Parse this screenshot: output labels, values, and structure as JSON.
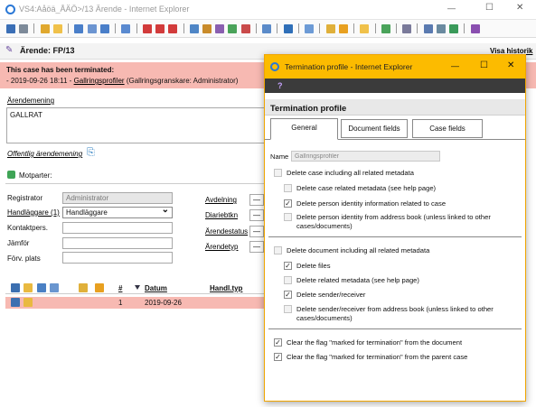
{
  "window": {
    "title": "VS4:Aåöä_ÅÄÖ>/13 Ärende - Internet Explorer",
    "min": "—",
    "max": "☐",
    "close": "✕"
  },
  "header": {
    "icon": "✎",
    "title": "Ärende: FP/13",
    "history_link": "Visa historik"
  },
  "banner": {
    "title": "This case has been terminated:",
    "line_prefix": "-  2019-09-26 18:11 -",
    "line_link": "Gallringsprofiler",
    "line_suffix": "(Gallringsgranskare: Administrator)"
  },
  "case": {
    "label": "Ärendemening",
    "value": "GALLRAT",
    "public_label": "Offentlig ärendemening",
    "copy_icon": "⎘"
  },
  "motparter": {
    "label": "Motparter:"
  },
  "form": {
    "registrator_label": "Registrator",
    "registrator_value": "Administrator",
    "handlaggare_label": "Handläggare (1)",
    "handlaggare_value": "Handläggare",
    "handlaggare_arrow": "⌄",
    "kontakt_label": "Kontaktpers.",
    "jamfor_label": "Jämför",
    "forvplats_label": "Förv. plats",
    "avdelning_label": "Avdelning",
    "diarie_label": "Diariebtkn",
    "arendestatus_label": "Ärendestatus",
    "arendetyp_label": "Ärendetyp",
    "dash": "—"
  },
  "table": {
    "hash_label": "#",
    "datum_label": "Datum",
    "handl_label": "Handl.typ",
    "row_num": "1",
    "row_date": "2019-09-26"
  },
  "dialog": {
    "title": "Termination profile - Internet Explorer",
    "help": "?",
    "heading": "Termination profile",
    "min": "—",
    "max": "☐",
    "close": "✕",
    "tabs": [
      "General",
      "Document fields",
      "Case fields"
    ],
    "name_label": "Name",
    "name_value": "Gallringsprofiler",
    "delete_case": "Delete case including all related metadata",
    "case_related": "Delete case related metadata (see help page)",
    "person_identity": "Delete person identity information related to case",
    "person_addressbook": "Delete person identity from address book (unless linked to other cases/documents)",
    "delete_doc": "Delete document including all related metadata",
    "delete_files": "Delete files",
    "related_meta": "Delete related metadata (see help page)",
    "sender_receiver": "Delete sender/receiver",
    "sender_addressbook": "Delete sender/receiver from address book (unless linked to other cases/documents)",
    "clear_doc": "Clear the flag \"marked for termination\" from the document",
    "clear_case": "Clear the flag \"marked for termination\" from the parent case",
    "check": "✓"
  }
}
